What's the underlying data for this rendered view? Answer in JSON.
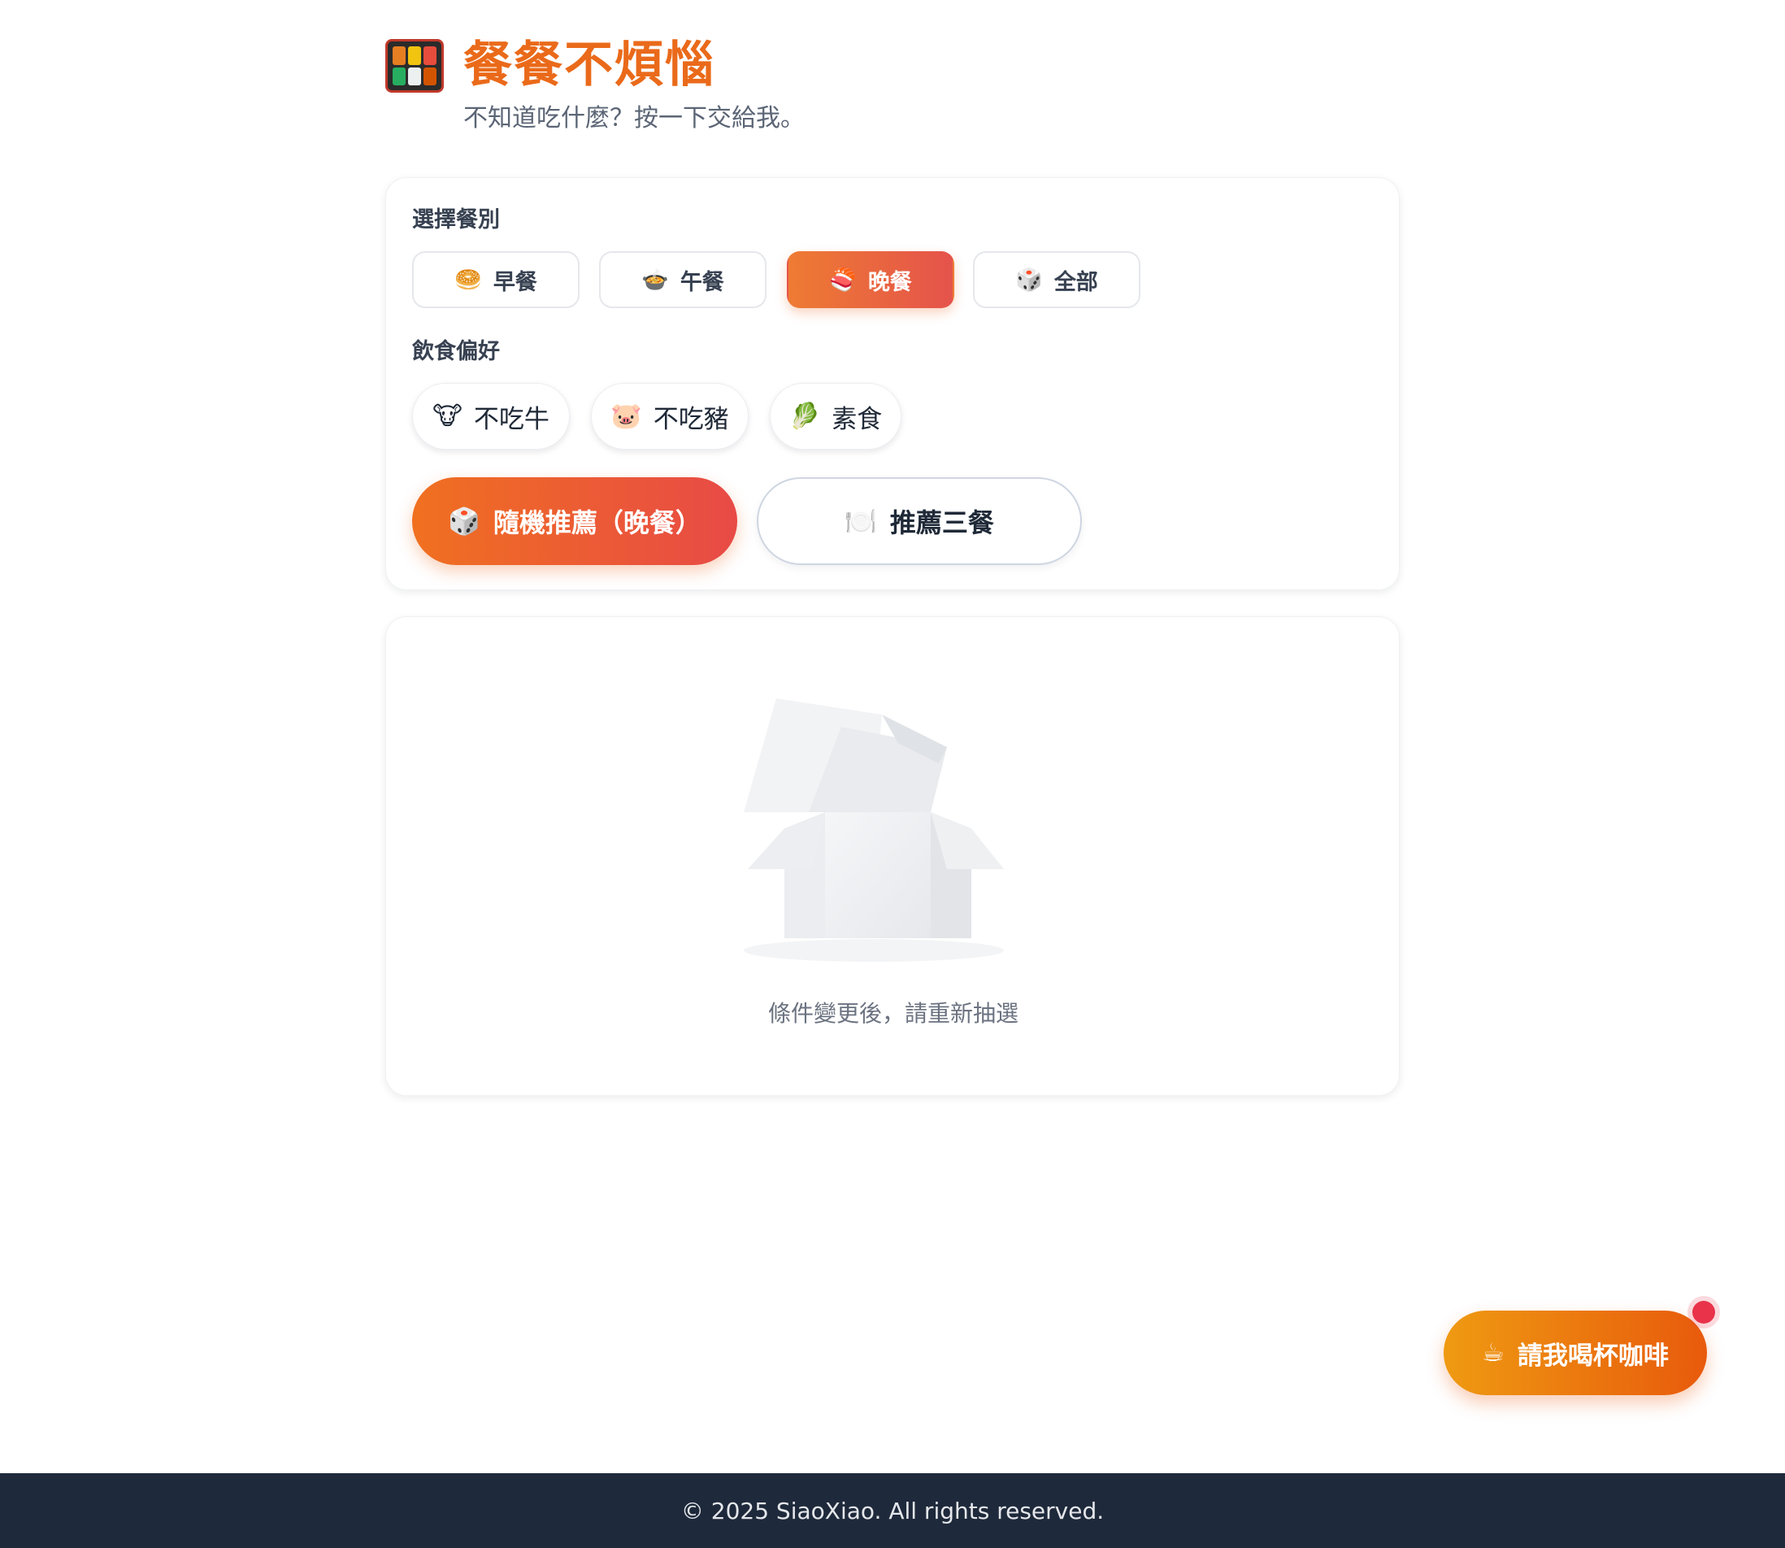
{
  "header": {
    "title": "餐餐不煩惱",
    "subtitle": "不知道吃什麼？按一下交給我。",
    "logo_icon": "bento-box-icon"
  },
  "options": {
    "meal_label": "選擇餐別",
    "meals": [
      {
        "label": "早餐",
        "icon": "bagel-icon",
        "glyph": "🥯",
        "selected": false
      },
      {
        "label": "午餐",
        "icon": "bowl-icon",
        "glyph": "🍲",
        "selected": false
      },
      {
        "label": "晚餐",
        "icon": "sushi-icon",
        "glyph": "🍣",
        "selected": true
      },
      {
        "label": "全部",
        "icon": "dice-icon",
        "glyph": "🎲",
        "selected": false
      }
    ],
    "preference_label": "飲食偏好",
    "preferences": [
      {
        "label": "不吃牛",
        "icon": "cow-face-icon",
        "glyph": "🐮"
      },
      {
        "label": "不吃豬",
        "icon": "pig-face-icon",
        "glyph": "🐷"
      },
      {
        "label": "素食",
        "icon": "leafy-green-icon",
        "glyph": "🥬"
      }
    ],
    "random_button": {
      "label": "隨機推薦（晚餐）",
      "glyph": "🎲"
    },
    "three_meals_button": {
      "label": "推薦三餐",
      "glyph": "🍽️"
    }
  },
  "result": {
    "empty_text": "條件變更後，請重新抽選",
    "illustration": "empty-box-illustration"
  },
  "coffee_button": {
    "label": "請我喝杯咖啡",
    "glyph": "☕"
  },
  "footer": {
    "text": "© 2025 SiaoXiao. All rights reserved."
  },
  "colors": {
    "accent": "#ea6a1a",
    "gradient_start": "#f07020",
    "gradient_end": "#e84a46",
    "footer_bg": "#1e293b",
    "notify": "#e8334a"
  }
}
